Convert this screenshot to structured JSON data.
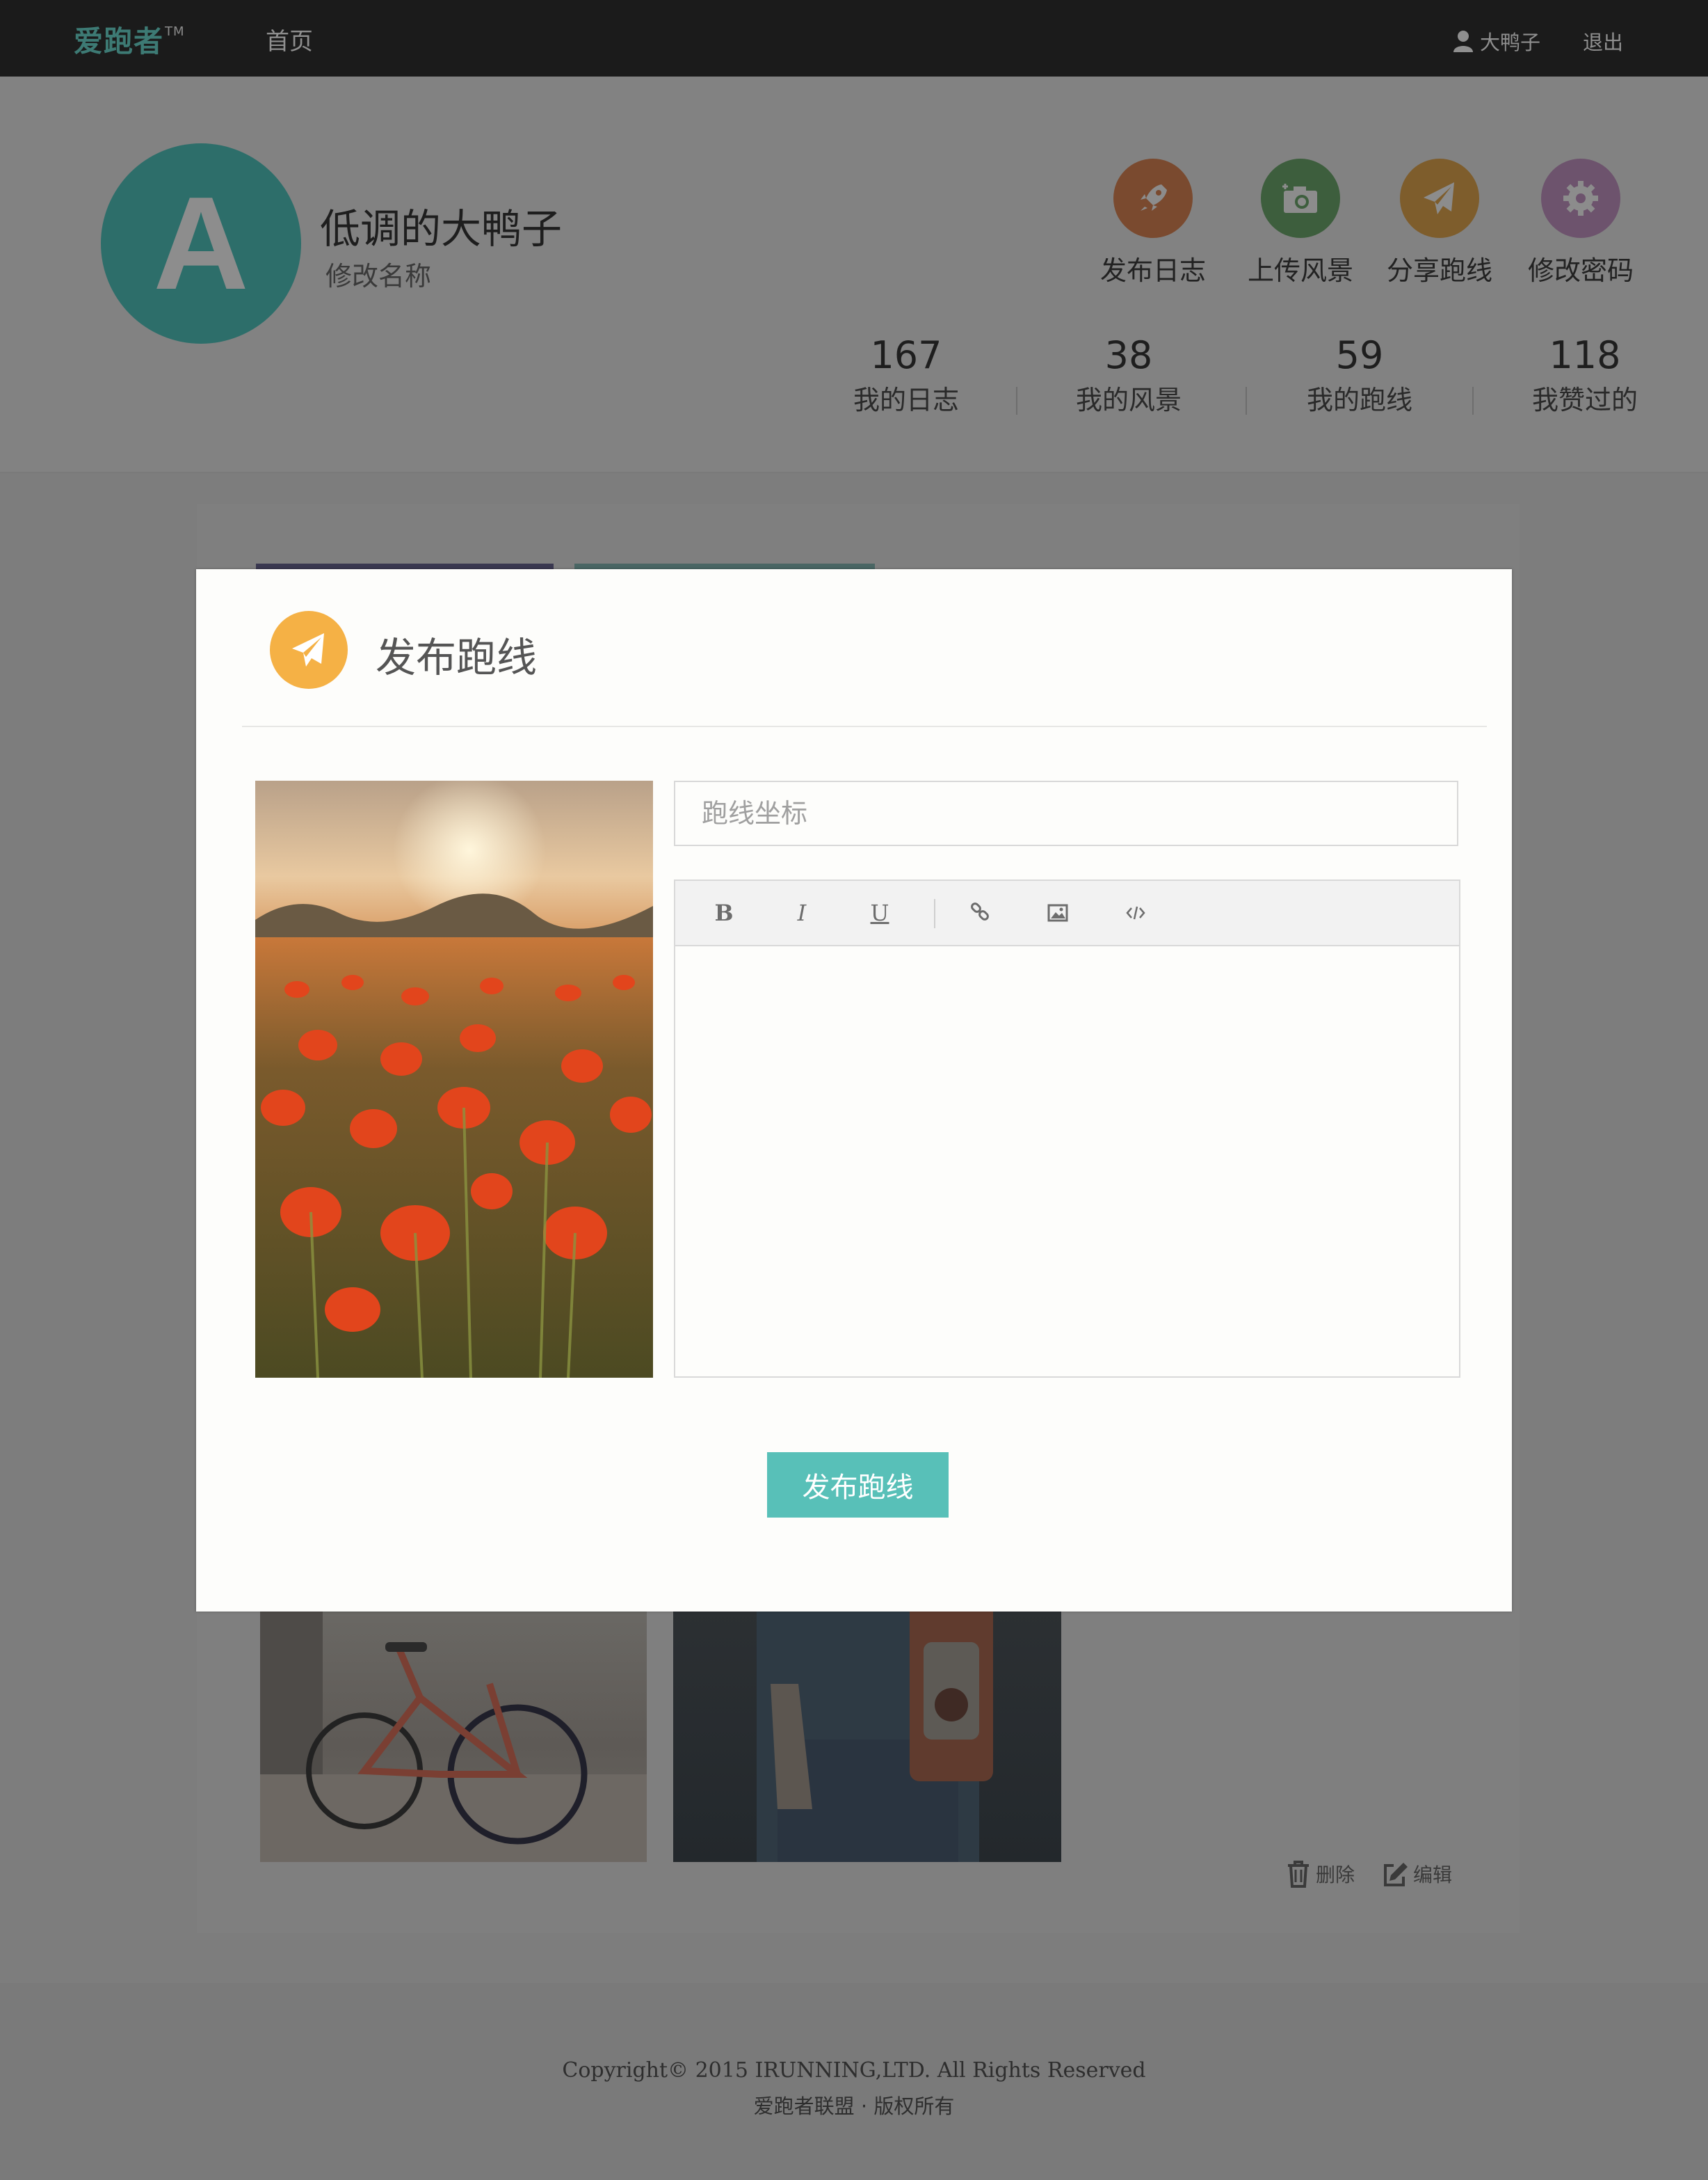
{
  "nav": {
    "logo": "爱跑者",
    "logo_tm": "TM",
    "home": "首页",
    "user": "大鸭子",
    "logout": "退出"
  },
  "profile": {
    "avatar_letter": "A",
    "name": "低调的大鸭子",
    "rename_label": "修改名称",
    "actions": [
      {
        "label": "发布日志",
        "icon": "rocket-icon",
        "color": "#d9622a"
      },
      {
        "label": "上传风景",
        "icon": "camera-icon",
        "color": "#3f8f3f"
      },
      {
        "label": "分享跑线",
        "icon": "paper-plane-icon",
        "color": "#d98b1f"
      },
      {
        "label": "修改密码",
        "icon": "gear-icon",
        "color": "#9b4f9b"
      }
    ],
    "stats": [
      {
        "num": "167",
        "label": "我的日志"
      },
      {
        "num": "38",
        "label": "我的风景"
      },
      {
        "num": "59",
        "label": "我的跑线"
      },
      {
        "num": "118",
        "label": "我赞过的"
      }
    ]
  },
  "card": {
    "delete_label": "删除",
    "edit_label": "编辑"
  },
  "modal": {
    "title": "发布跑线",
    "icon": "paper-plane-icon",
    "input_placeholder": "跑线坐标",
    "toolbar": [
      "B",
      "I",
      "U",
      "link-icon",
      "image-icon",
      "code-icon"
    ],
    "submit_label": "发布跑线",
    "colors": {
      "accent": "#58c0b8",
      "icon_bg": "#f5b145"
    }
  },
  "footer": {
    "copyright": "Copyright© 2015 IRUNNING,LTD. All Rights Reserved",
    "rights": "爱跑者联盟 · 版权所有"
  }
}
